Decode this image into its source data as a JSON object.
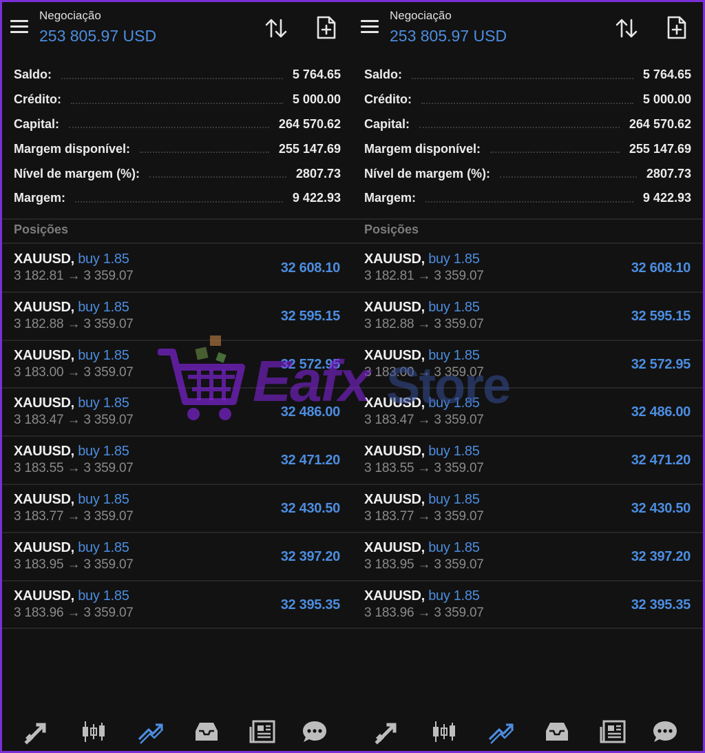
{
  "panels": [
    {
      "header": {
        "title": "Negociação",
        "equity": "253 805.97 USD"
      },
      "summary": [
        {
          "label": "Saldo:",
          "value": "5 764.65"
        },
        {
          "label": "Crédito:",
          "value": "5 000.00"
        },
        {
          "label": "Capital:",
          "value": "264 570.62"
        },
        {
          "label": "Margem disponível:",
          "value": "255 147.69"
        },
        {
          "label": "Nível de margem (%):",
          "value": "2807.73"
        },
        {
          "label": "Margem:",
          "value": "9 422.93"
        }
      ],
      "positions_label": "Posições",
      "positions": [
        {
          "symbol": "XAUUSD,",
          "side": "buy 1.85",
          "prices": "3 182.81 → 3 359.07",
          "profit": "32 608.10"
        },
        {
          "symbol": "XAUUSD,",
          "side": "buy 1.85",
          "prices": "3 182.88 → 3 359.07",
          "profit": "32 595.15"
        },
        {
          "symbol": "XAUUSD,",
          "side": "buy 1.85",
          "prices": "3 183.00 → 3 359.07",
          "profit": "32 572.95"
        },
        {
          "symbol": "XAUUSD,",
          "side": "buy 1.85",
          "prices": "3 183.47 → 3 359.07",
          "profit": "32 486.00"
        },
        {
          "symbol": "XAUUSD,",
          "side": "buy 1.85",
          "prices": "3 183.55 → 3 359.07",
          "profit": "32 471.20"
        },
        {
          "symbol": "XAUUSD,",
          "side": "buy 1.85",
          "prices": "3 183.77 → 3 359.07",
          "profit": "32 430.50"
        },
        {
          "symbol": "XAUUSD,",
          "side": "buy 1.85",
          "prices": "3 183.95 → 3 359.07",
          "profit": "32 397.20"
        },
        {
          "symbol": "XAUUSD,",
          "side": "buy 1.85",
          "prices": "3 183.96 → 3 359.07",
          "profit": "32 395.35"
        }
      ]
    },
    {
      "header": {
        "title": "Negociação",
        "equity": "253 805.97 USD"
      },
      "summary": [
        {
          "label": "Saldo:",
          "value": "5 764.65"
        },
        {
          "label": "Crédito:",
          "value": "5 000.00"
        },
        {
          "label": "Capital:",
          "value": "264 570.62"
        },
        {
          "label": "Margem disponível:",
          "value": "255 147.69"
        },
        {
          "label": "Nível de margem (%):",
          "value": "2807.73"
        },
        {
          "label": "Margem:",
          "value": "9 422.93"
        }
      ],
      "positions_label": "Posições",
      "positions": [
        {
          "symbol": "XAUUSD,",
          "side": "buy 1.85",
          "prices": "3 182.81 → 3 359.07",
          "profit": "32 608.10"
        },
        {
          "symbol": "XAUUSD,",
          "side": "buy 1.85",
          "prices": "3 182.88 → 3 359.07",
          "profit": "32 595.15"
        },
        {
          "symbol": "XAUUSD,",
          "side": "buy 1.85",
          "prices": "3 183.00 → 3 359.07",
          "profit": "32 572.95"
        },
        {
          "symbol": "XAUUSD,",
          "side": "buy 1.85",
          "prices": "3 183.47 → 3 359.07",
          "profit": "32 486.00"
        },
        {
          "symbol": "XAUUSD,",
          "side": "buy 1.85",
          "prices": "3 183.55 → 3 359.07",
          "profit": "32 471.20"
        },
        {
          "symbol": "XAUUSD,",
          "side": "buy 1.85",
          "prices": "3 183.77 → 3 359.07",
          "profit": "32 430.50"
        },
        {
          "symbol": "XAUUSD,",
          "side": "buy 1.85",
          "prices": "3 183.95 → 3 359.07",
          "profit": "32 397.20"
        },
        {
          "symbol": "XAUUSD,",
          "side": "buy 1.85",
          "prices": "3 183.96 → 3 359.07",
          "profit": "32 395.35"
        }
      ]
    }
  ],
  "header_icons": [
    "menu-icon",
    "sort-icon",
    "new-order-icon"
  ],
  "nav_icons": [
    "quotes-icon",
    "chart-icon",
    "trade-icon",
    "history-icon",
    "news-icon",
    "messages-icon"
  ],
  "watermark": {
    "part1": "Eafx",
    "part2": "Store"
  },
  "colors": {
    "frame": "#7b2fd6",
    "background": "#121212",
    "accent": "#4c8de0",
    "text": "#ececec",
    "muted": "#8a8a8a",
    "nav_icon": "#bdbdbd",
    "nav_active": "#4c8de0"
  }
}
